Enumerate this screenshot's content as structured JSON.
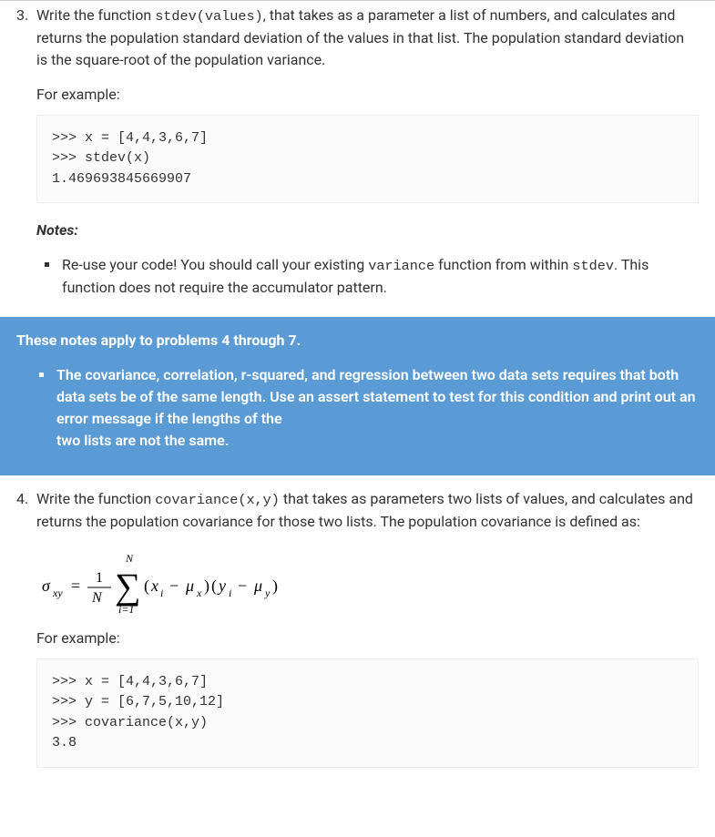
{
  "problem3": {
    "number": "3.",
    "text_before_code1": "Write the function ",
    "code1": "stdev(values)",
    "text_after_code1": ", that takes as a parameter a list of numbers, and calculates and returns the population standard deviation of the values in that list. The population standard deviation is the square-root of the population variance.",
    "for_example": "For example:",
    "code_block": ">>> x = [4,4,3,6,7]\n>>> stdev(x)\n1.469693845669907",
    "notes_heading": "Notes:",
    "note1_before": "Re-use your code! You should call your existing ",
    "note1_code1": "variance",
    "note1_mid": " function from within ",
    "note1_code2": "stdev",
    "note1_after": ". This function does not require the accumulator pattern."
  },
  "callout": {
    "title": "These notes apply to problems 4 through 7.",
    "bullet1": "The covariance, correlation, r-squared, and regression between two data sets requires that both data sets be of the same length. Use an assert statement to test for this condition and print out an error message if the lengths of the",
    "bullet1_line2": "two lists are not the same."
  },
  "problem4": {
    "number": "4.",
    "text_before_code1": "Write the function ",
    "code1": "covariance(x,y)",
    "text_after_code1": " that takes as parameters two lists of values, and calculates and returns the population covariance for those two lists. The population covariance is defined as:",
    "for_example": "For example:",
    "code_block": ">>> x = [4,4,3,6,7]\n>>> y = [6,7,5,10,12]\n>>> covariance(x,y)\n3.8"
  }
}
